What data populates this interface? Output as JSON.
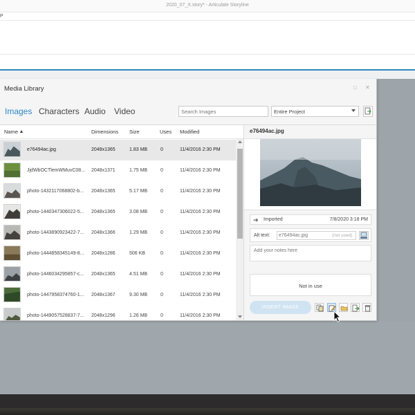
{
  "app": {
    "title": "2020_07_X.story* - Articulate Storyline",
    "ribbon_tab": "P"
  },
  "dialog": {
    "title": "Media Library",
    "maximize_icon": "□",
    "close_icon": "✕",
    "tabs": [
      {
        "label": "Images",
        "active": true
      },
      {
        "label": "Characters",
        "active": false
      },
      {
        "label": "Audio",
        "active": false
      },
      {
        "label": "Video",
        "active": false
      }
    ],
    "search": {
      "placeholder": "Search Images",
      "value": ""
    },
    "scope": {
      "selected": "Entire Project"
    }
  },
  "table": {
    "columns": [
      "Name",
      "Dimensions",
      "Size",
      "Uses",
      "Modified"
    ],
    "sorted_by": "Name",
    "rows": [
      {
        "name": "e76494ac.jpg",
        "dimensions": "2048x1365",
        "size": "1.83 MB",
        "uses": "0",
        "modified": "11/4/2016 2:30 PM",
        "selected": true
      },
      {
        "name": "JjdWbOCTlemWMuvC08...",
        "dimensions": "2048x1371",
        "size": "1.75 MB",
        "uses": "0",
        "modified": "11/4/2016 2:30 PM",
        "selected": false
      },
      {
        "name": "photo-1432117068802-b...",
        "dimensions": "2048x1365",
        "size": "5.17 MB",
        "uses": "0",
        "modified": "11/4/2016 2:30 PM",
        "selected": false
      },
      {
        "name": "photo-1440347306022-5...",
        "dimensions": "2048x1365",
        "size": "3.08 MB",
        "uses": "0",
        "modified": "11/4/2016 2:30 PM",
        "selected": false
      },
      {
        "name": "photo-1443890923422-7...",
        "dimensions": "2048x1366",
        "size": "1.29 MB",
        "uses": "0",
        "modified": "11/4/2016 2:30 PM",
        "selected": false
      },
      {
        "name": "photo-1444858345149-8...",
        "dimensions": "2048x1286",
        "size": "506 KB",
        "uses": "0",
        "modified": "11/4/2016 2:30 PM",
        "selected": false
      },
      {
        "name": "photo-1446034295857-c...",
        "dimensions": "2048x1365",
        "size": "4.51 MB",
        "uses": "0",
        "modified": "11/4/2016 2:30 PM",
        "selected": false
      },
      {
        "name": "photo-1447958374760-1...",
        "dimensions": "2048x1367",
        "size": "9.30 MB",
        "uses": "0",
        "modified": "11/4/2016 2:30 PM",
        "selected": false
      },
      {
        "name": "photo-1449057528837-7...",
        "dimensions": "2048x1296",
        "size": "1.26 MB",
        "uses": "0",
        "modified": "11/4/2016 2:30 PM",
        "selected": false
      }
    ]
  },
  "details": {
    "filename": "e76494ac.jpg",
    "status_label": "Imported",
    "status_date": "7/8/2020 3:18 PM",
    "alt_text_label": "Alt text:",
    "alt_text_value": "e76494ac.jpg",
    "alt_text_hint": "(not used)",
    "notes_placeholder": "Add your notes here",
    "usage_text": "Not in use",
    "insert_label": "INSERT IMAGE"
  },
  "colors": {
    "accent": "#2b86c6",
    "insert_button": "#cfe3f2",
    "selected_row": "#e8e8e8"
  },
  "icons": {
    "status": "arrow-right-icon",
    "alt_text_button": "screen-reader-icon",
    "actions": [
      "copy-icon",
      "edit-icon",
      "open-folder-icon",
      "export-icon",
      "trash-icon"
    ],
    "toolbar": "export-icon"
  }
}
